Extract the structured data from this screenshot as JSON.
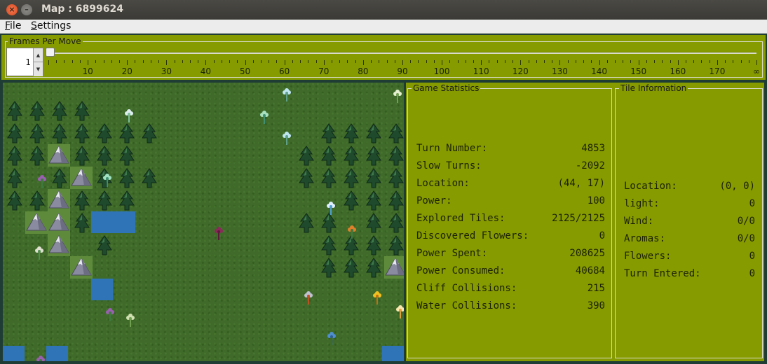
{
  "window": {
    "title": "Map : 6899624"
  },
  "menu": [
    {
      "label": "File",
      "mnemonic": "F",
      "rest": "ile"
    },
    {
      "label": "Settings",
      "mnemonic": "S",
      "rest": "ettings"
    }
  ],
  "fps": {
    "legend": "Frames Per Move",
    "value": "1",
    "tick_labels": [
      "10",
      "20",
      "30",
      "40",
      "50",
      "60",
      "70",
      "80",
      "90",
      "100",
      "110",
      "120",
      "130",
      "140",
      "150",
      "160",
      "170",
      "∞"
    ]
  },
  "game_stats": {
    "legend": "Game Statistics",
    "rows": [
      {
        "label": "Turn Number:",
        "value": "4853"
      },
      {
        "label": "Slow Turns:",
        "value": "-2092"
      },
      {
        "label": "Location:",
        "value": "(44, 17)"
      },
      {
        "label": "Power:",
        "value": "100"
      },
      {
        "label": "Explored Tiles:",
        "value": "2125/2125"
      },
      {
        "label": "Discovered Flowers:",
        "value": "0"
      },
      {
        "label": "Power Spent:",
        "value": "208625"
      },
      {
        "label": "Power Consumed:",
        "value": "40684"
      },
      {
        "label": "Cliff Collisions:",
        "value": "215"
      },
      {
        "label": "Water Collisions:",
        "value": "390"
      }
    ]
  },
  "tile_info": {
    "legend": "Tile Information",
    "rows": [
      {
        "label": "Location:",
        "value": "(0, 0)"
      },
      {
        "label": "light:",
        "value": "0"
      },
      {
        "label": "Wind:",
        "value": "0/0"
      },
      {
        "label": "Aromas:",
        "value": "0/0"
      },
      {
        "label": "Flowers:",
        "value": "0"
      },
      {
        "label": "Turn Entered:",
        "value": "0"
      }
    ]
  },
  "colors": {
    "panel": "#869b00",
    "grass": "#3f6a2a",
    "water": "#2e74b7",
    "tree": "#1f4a2c",
    "mountain": "#8a8aa0"
  },
  "icons": [
    "close-icon",
    "minimize-icon",
    "tree-icon",
    "mountain-icon",
    "flower-icon",
    "robot-icon"
  ]
}
